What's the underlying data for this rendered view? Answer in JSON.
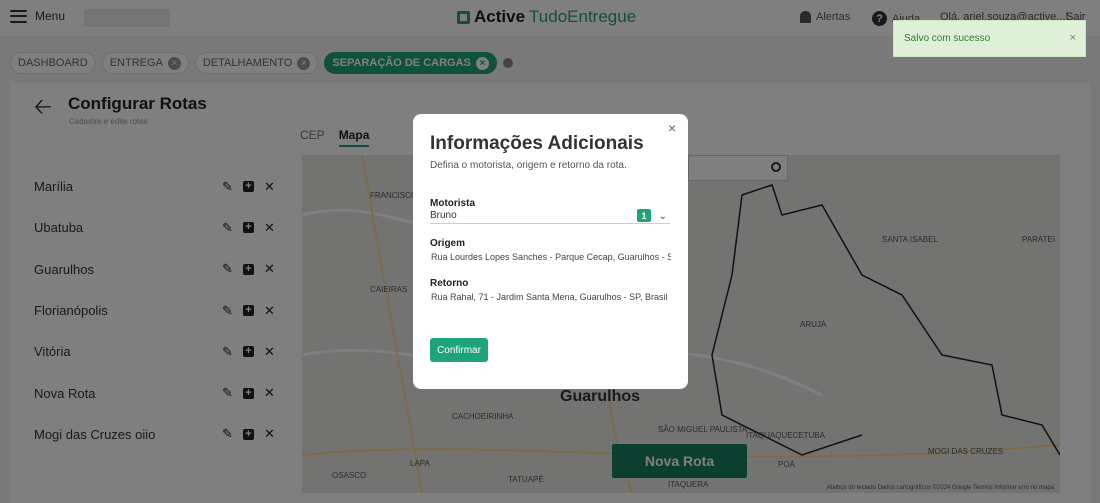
{
  "header": {
    "menu_label": "Menu",
    "logo_primary": "Active",
    "logo_secondary": "TudoEntregue",
    "alerts_label": "Alertas",
    "help_label": "Ajuda",
    "user_greeting": "Olá, ariel.souza@active...|",
    "logout_label": "Sair"
  },
  "breadcrumbs": [
    {
      "label": "DASHBOARD"
    },
    {
      "label": "ENTREGA"
    },
    {
      "label": "DETALHAMENTO"
    },
    {
      "label": "SEPARAÇÃO DE CARGAS"
    }
  ],
  "page": {
    "title": "Configurar Rotas",
    "subtitle": "Cadastre e edite rotas"
  },
  "routes": [
    {
      "name": "Marília"
    },
    {
      "name": "Ubatuba"
    },
    {
      "name": "Guarulhos"
    },
    {
      "name": "Florianópolis"
    },
    {
      "name": "Vitória"
    },
    {
      "name": "Nova Rota"
    },
    {
      "name": "Mogi das Cruzes oiio"
    }
  ],
  "tabs": [
    {
      "label": "CEP"
    },
    {
      "label": "Mapa"
    }
  ],
  "map": {
    "labels": [
      "Francisco Morato",
      "Caieiras",
      "Santa Isabel",
      "Paratei",
      "Arujá",
      "Cachoeirinha",
      "Itaquaquecetuba",
      "Mogi das Cruzes",
      "Poá",
      "Osasco",
      "Lapa",
      "Itaquera",
      "São Miguel Paulista",
      "Tatuapé"
    ],
    "main_city": "Guarulhos",
    "new_route_button": "Nova Rota",
    "attribution": "Atalhos do teclado   Dados cartográficos ©2024 Google   Termos   Informar erro no mapa"
  },
  "modal": {
    "title": "Informações Adicionais",
    "subtitle": "Defina o motorista, origem e retorno da rota.",
    "close_symbol": "×",
    "driver_label": "Motorista",
    "driver_value": "Bruno",
    "driver_badge": "1",
    "origin_label": "Origem",
    "origin_value": "Rua Lourdes Lopes Sanches - Parque Cecap, Guarulhos - SP, Brasil",
    "return_label": "Retorno",
    "return_value": "Rua Rahal, 71 - Jardim Santa Mena, Guarulhos - SP, Brasil",
    "confirm_button": "Confirmar"
  },
  "toast": {
    "message": "Salvo com sucesso",
    "close_symbol": "×"
  }
}
